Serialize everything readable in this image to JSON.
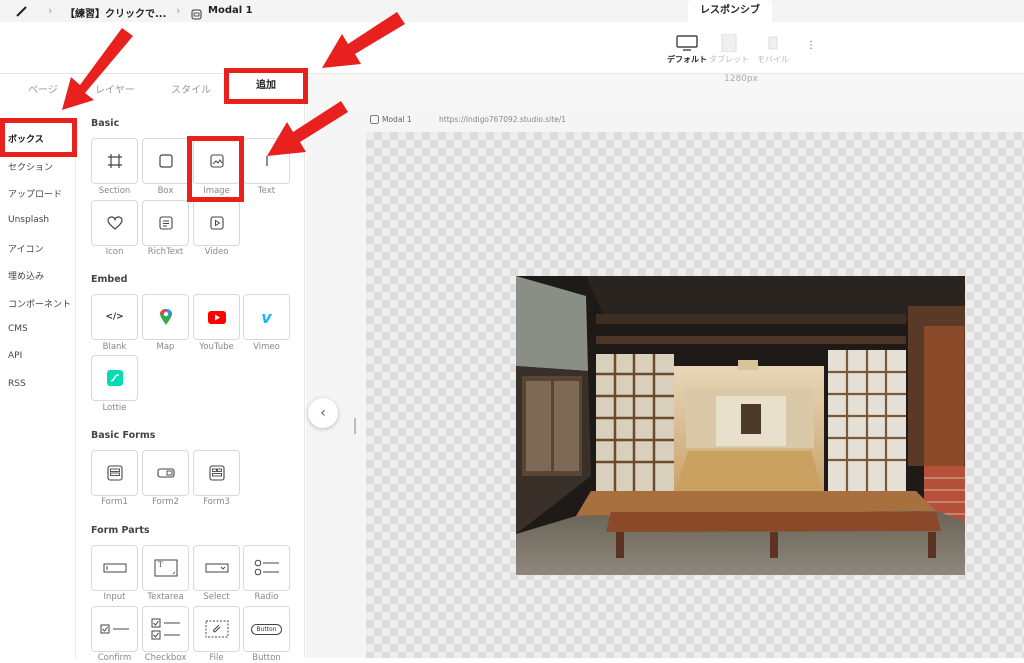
{
  "topbar": {
    "breadcrumb_project": "【練習】クリックで...",
    "breadcrumb_page": "Modal 1",
    "responsive_tab": "レスポンシブ",
    "devices": [
      {
        "label": "デフォルト",
        "active": true
      },
      {
        "label": "タブレット",
        "active": false
      },
      {
        "label": "モバイル",
        "active": false
      }
    ],
    "width_label": "1280px"
  },
  "panel_tabs": [
    "ページ",
    "レイヤー",
    "スタイル",
    "追加"
  ],
  "left_nav": [
    "ボックス",
    "セクション",
    "アップロード",
    "Unsplash",
    "アイコン",
    "埋め込み",
    "コンポーネント",
    "CMS",
    "API",
    "RSS"
  ],
  "sections": {
    "basic": {
      "title": "Basic",
      "items": [
        "Section",
        "Box",
        "Image",
        "Text",
        "Icon",
        "RichText",
        "Video"
      ]
    },
    "embed": {
      "title": "Embed",
      "items": [
        "Blank",
        "Map",
        "YouTube",
        "Vimeo",
        "Lottie"
      ]
    },
    "basic_forms": {
      "title": "Basic Forms",
      "items": [
        "Form1",
        "Form2",
        "Form3"
      ]
    },
    "form_parts": {
      "title": "Form Parts",
      "items": [
        "Input",
        "Textarea",
        "Select",
        "Radio",
        "Confirm",
        "Checkbox",
        "File",
        "Button"
      ]
    }
  },
  "canvas": {
    "page_name": "Modal 1",
    "url": "https://indigo767092.studio.site/1"
  },
  "colors": {
    "highlight": "#e8201e",
    "youtube": "#ff0000",
    "vimeo": "#1ab7ea",
    "lottie": "#00ddb3"
  }
}
